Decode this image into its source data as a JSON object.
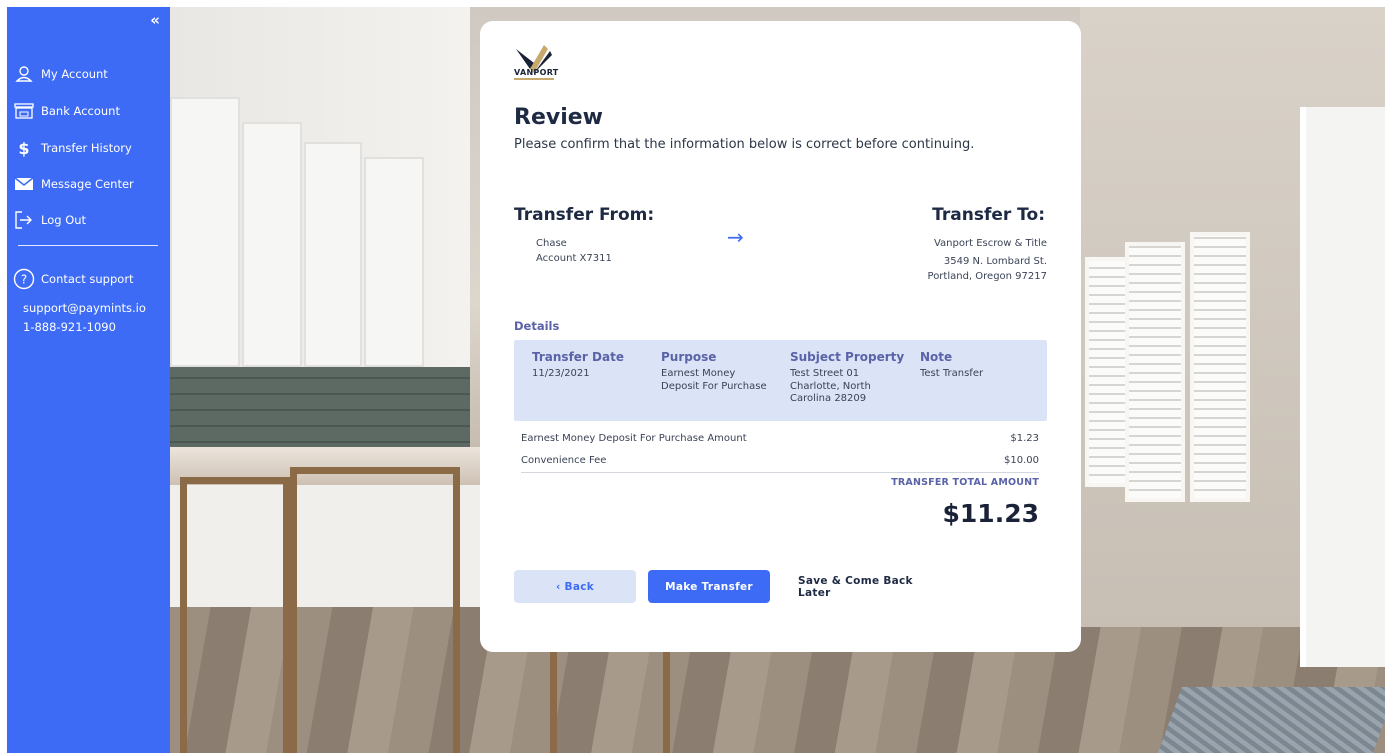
{
  "sidebar": {
    "collapse_label": "«",
    "items": [
      {
        "label": "My Account",
        "icon": "user-icon"
      },
      {
        "label": "Bank Account",
        "icon": "bank-icon"
      },
      {
        "label": "Transfer History",
        "icon": "dollar-icon"
      },
      {
        "label": "Message Center",
        "icon": "envelope-icon"
      },
      {
        "label": "Log Out",
        "icon": "logout-icon"
      }
    ],
    "support": {
      "label": "Contact support",
      "icon": "question-circle-icon",
      "email": "support@paymints.io",
      "phone": "1-888-921-1090"
    }
  },
  "card": {
    "logo_text": "VANPORT",
    "title": "Review",
    "subtitle": "Please confirm that the information below is correct before continuing.",
    "transfer_from": {
      "heading": "Transfer From:",
      "bank": "Chase",
      "account": "Account X7311"
    },
    "transfer_to": {
      "heading": "Transfer To:",
      "name": "Vanport Escrow & Title",
      "street": "3549 N. Lombard St.",
      "city": "Portland, Oregon 97217"
    },
    "details": {
      "heading": "Details",
      "transfer_date": {
        "label": "Transfer Date",
        "value": "11/23/2021"
      },
      "purpose": {
        "label": "Purpose",
        "line1": "Earnest Money",
        "line2": "Deposit For Purchase"
      },
      "subject_property": {
        "label": "Subject Property",
        "line1": "Test Street 01",
        "line2": "Charlotte, North",
        "line3": "Carolina 28209"
      },
      "note": {
        "label": "Note",
        "value": "Test Transfer"
      }
    },
    "line_items": [
      {
        "label": "Earnest Money Deposit For Purchase Amount",
        "amount": "$1.23"
      },
      {
        "label": "Convenience Fee",
        "amount": "$10.00"
      }
    ],
    "total_label": "TRANSFER TOTAL AMOUNT",
    "total_amount": "$11.23",
    "buttons": {
      "back": "‹ Back",
      "make_transfer": "Make Transfer",
      "save_later": "Save & Come Back Later"
    }
  },
  "colors": {
    "accent": "#3d6bf5",
    "details_bg": "#dbe4f7",
    "heading_purple": "#5a62a8",
    "dark_text": "#1e2a44"
  }
}
